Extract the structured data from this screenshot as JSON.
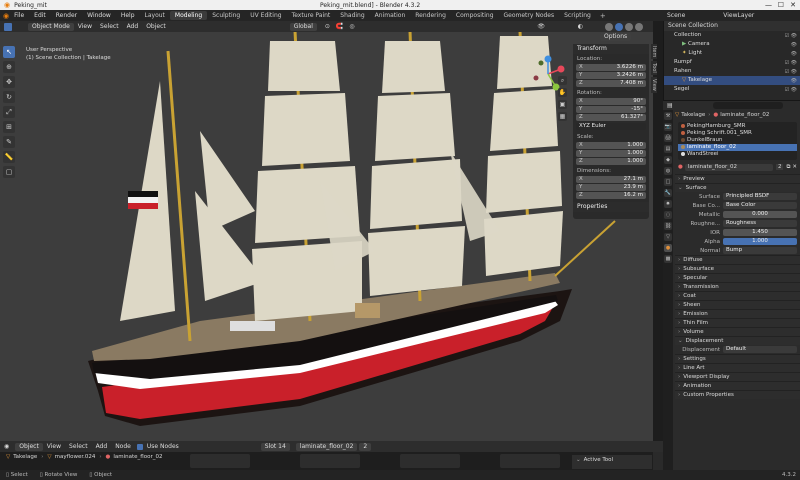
{
  "window": {
    "app_name": "Peking_mit",
    "title": "Peking_mit.blend] - Blender 4.3.2"
  },
  "menus": [
    "File",
    "Edit",
    "Render",
    "Window",
    "Help"
  ],
  "workspaces": [
    "Layout",
    "Modeling",
    "Sculpting",
    "UV Editing",
    "Texture Paint",
    "Shading",
    "Animation",
    "Rendering",
    "Compositing",
    "Geometry Nodes",
    "Scripting"
  ],
  "active_workspace": "Modeling",
  "scene": {
    "scene_label": "Scene",
    "view_layer": "ViewLayer"
  },
  "viewport": {
    "mode": "Object Mode",
    "menus": [
      "View",
      "Select",
      "Add",
      "Object"
    ],
    "orientation": "Global",
    "options_label": "Options",
    "overlay_title": "User Perspective",
    "overlay_path": "(1) Scene Collection | Takelage"
  },
  "npanel": {
    "header": "Transform",
    "location_label": "Location:",
    "location": [
      {
        "k": "X",
        "v": "3.6226 m"
      },
      {
        "k": "Y",
        "v": "3.2426 m"
      },
      {
        "k": "Z",
        "v": "7.408 m"
      }
    ],
    "rotation_label": "Rotation:",
    "rotation": [
      {
        "k": "X",
        "v": "90°"
      },
      {
        "k": "Y",
        "v": "-15°"
      },
      {
        "k": "Z",
        "v": "61.327°"
      }
    ],
    "rotation_mode": "XYZ Euler",
    "scale_label": "Scale:",
    "scale": [
      {
        "k": "X",
        "v": "1.000"
      },
      {
        "k": "Y",
        "v": "1.000"
      },
      {
        "k": "Z",
        "v": "1.000"
      }
    ],
    "dimensions_label": "Dimensions:",
    "dimensions": [
      {
        "k": "X",
        "v": "27.1 m"
      },
      {
        "k": "Y",
        "v": "23.9 m"
      },
      {
        "k": "Z",
        "v": "16.2 m"
      }
    ],
    "properties_label": "Properties",
    "tabs": [
      "Item",
      "Tool",
      "View"
    ]
  },
  "outliner": {
    "header": "Scene Collection",
    "items": [
      {
        "label": "Collection",
        "level": 1
      },
      {
        "label": "Camera",
        "level": 2
      },
      {
        "label": "Light",
        "level": 2
      },
      {
        "label": "Rumpf",
        "level": 1
      },
      {
        "label": "Rahen",
        "level": 1
      },
      {
        "label": "Takelage",
        "level": 2,
        "selected": true
      },
      {
        "label": "Segel",
        "level": 1
      }
    ]
  },
  "properties": {
    "object_name": "Takelage",
    "material_name": "laminate_floor_02",
    "slots": [
      "PekingHamburg_SMR",
      "Peking Schrift.001_SMR",
      "DunkelBraun",
      "laminate_floor_02",
      "WandStreei"
    ],
    "active_slot": "laminate_floor_02",
    "material_field": "laminate_floor_02",
    "user_count": "2",
    "sections": {
      "preview": "Preview",
      "surface": "Surface",
      "diffuse": "Diffuse",
      "subsurface": "Subsurface",
      "specular": "Specular",
      "transmission": "Transmission",
      "coat": "Coat",
      "sheen": "Sheen",
      "emission": "Emission",
      "thin_film": "Thin Film",
      "volume": "Volume",
      "displacement": "Displacement",
      "settings": "Settings",
      "line_art": "Line Art",
      "viewport_display": "Viewport Display",
      "animation": "Animation",
      "custom_properties": "Custom Properties"
    },
    "surface_rows": [
      {
        "label": "Surface",
        "value": "Principled BSDF",
        "style": "link"
      },
      {
        "label": "Base Co...",
        "value": "Base Color",
        "style": "link"
      },
      {
        "label": "Metallic",
        "value": "0.000",
        "style": "num"
      },
      {
        "label": "Roughne...",
        "value": "Roughness",
        "style": "link"
      },
      {
        "label": "IOR",
        "value": "1.450",
        "style": "num"
      },
      {
        "label": "Alpha",
        "value": "1.000",
        "style": "blue"
      },
      {
        "label": "Normal",
        "value": "Bump",
        "style": "link"
      }
    ],
    "displacement_row": {
      "label": "Displacement",
      "value": "Default"
    }
  },
  "shader_header": {
    "editor": "Object",
    "menus": [
      "View",
      "Select",
      "Add",
      "Node"
    ],
    "use_nodes": "Use Nodes",
    "slot": "Slot 14",
    "material": "laminate_floor_02",
    "users": "2"
  },
  "breadcrumb": [
    "Takelage",
    "mayflower.024",
    "laminate_floor_02"
  ],
  "active_tool": "Active Tool",
  "status": {
    "select": "Select",
    "rotate": "Rotate View",
    "object": "Object",
    "version": "4.3.2"
  },
  "colors": {
    "accent": "#4772b3",
    "hull_black": "#1c1412",
    "hull_red": "#c9202a",
    "sail": "#ddd8c6",
    "mast": "#c9a233"
  }
}
